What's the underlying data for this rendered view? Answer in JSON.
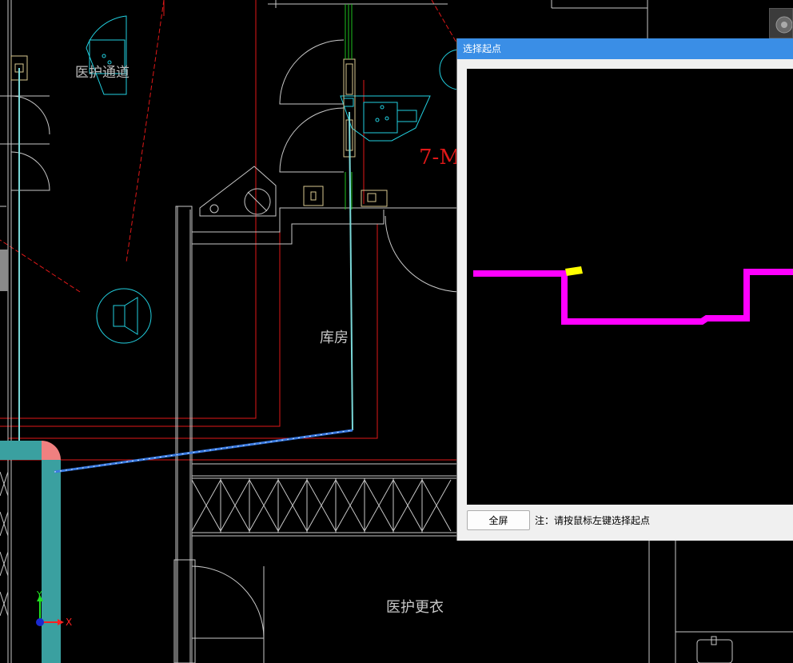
{
  "canvas": {
    "rooms": {
      "nurse_corridor": "医护通道",
      "storage": "库房",
      "nurse_changing": "医护更衣",
      "door_tag": "7-M"
    },
    "ucs": {
      "x_label": "X",
      "y_label": "Y"
    }
  },
  "dialog": {
    "title": "选择起点",
    "fullscreen_label": "全屏",
    "hint": "注：请按鼠标左键选择起点"
  },
  "colors": {
    "wall": "#c8c8c8",
    "red_line": "#e01818",
    "fixture": "#22d0e0",
    "duct": "#3aa0a0",
    "duct_corner": "#f08080",
    "pipe": "#3a7ae0",
    "green": "#1ec01e",
    "tan": "#d8c890",
    "preview_path": "#ff00ff",
    "preview_marker": "#ffff00",
    "titlebar": "#3a8ee6"
  },
  "icons": [
    "navigation-cube-icon",
    "ucs-axis-icon"
  ]
}
